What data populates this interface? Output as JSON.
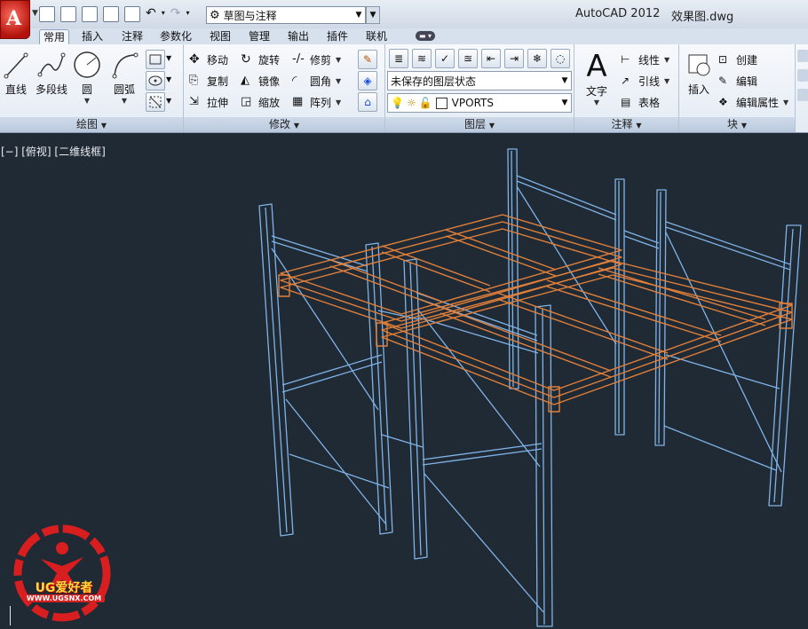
{
  "titlebar": {
    "app_letter": "A",
    "workspace": "草图与注释",
    "app_title": "AutoCAD 2012",
    "file_title": "效果图.dwg"
  },
  "tabs": [
    "常用",
    "插入",
    "注释",
    "参数化",
    "视图",
    "管理",
    "输出",
    "插件",
    "联机"
  ],
  "ribbon": {
    "draw": {
      "title": "绘图",
      "line": "直线",
      "polyline": "多段线",
      "circle": "圆",
      "arc": "圆弧"
    },
    "modify": {
      "title": "修改",
      "move": "移动",
      "rotate": "旋转",
      "trim": "修剪",
      "copy": "复制",
      "mirror": "镜像",
      "fillet": "圆角",
      "stretch": "拉伸",
      "scale": "缩放",
      "array": "阵列"
    },
    "layers": {
      "title": "图层",
      "layer_state": "未保存的图层状态",
      "current_layer": "VPORTS"
    },
    "annotation": {
      "title": "注释",
      "text": "文字",
      "linear": "线性",
      "leader": "引线",
      "table": "表格"
    },
    "block": {
      "title": "块",
      "insert": "插入",
      "create": "创建",
      "edit": "编辑",
      "edit_attributes": "编辑属性"
    }
  },
  "viewport": {
    "label": "[−] [俯视] [二维线框]"
  },
  "watermark": {
    "brand": "UG爱好者",
    "url": "WWW.UGSNX.COM"
  },
  "colors": {
    "viewport_bg": "#202a35",
    "frame_blue": "#7fb4e8",
    "beam_orange": "#e2803a"
  }
}
